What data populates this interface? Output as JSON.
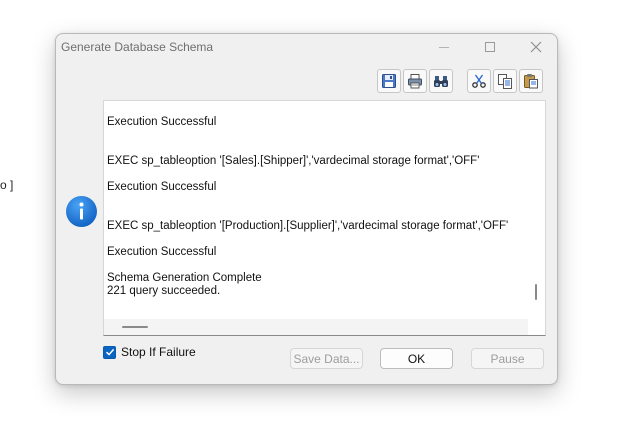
{
  "background": {
    "fragment_text": "o ]"
  },
  "dialog": {
    "title": "Generate Database Schema"
  },
  "toolbar": {
    "buttons": [
      {
        "name": "save",
        "icon": "save-icon"
      },
      {
        "name": "print",
        "icon": "print-icon"
      },
      {
        "name": "find",
        "icon": "binoculars-icon"
      },
      {
        "name": "cut",
        "icon": "scissors-icon"
      },
      {
        "name": "copy",
        "icon": "copy-icon"
      },
      {
        "name": "paste",
        "icon": "paste-icon"
      }
    ]
  },
  "log": {
    "lines": [
      "Execution Successful",
      "EXEC sp_tableoption '[Sales].[Shipper]','vardecimal storage format','OFF'",
      "Execution Successful",
      "EXEC sp_tableoption '[Production].[Supplier]','vardecimal storage format','OFF'",
      "Execution Successful",
      "Schema Generation Complete",
      "221 query succeeded."
    ]
  },
  "options": {
    "stop_if_failure_label": "Stop If Failure",
    "stop_if_failure_checked": true
  },
  "buttons": {
    "save_data": "Save Data...",
    "ok": "OK",
    "pause": "Pause"
  },
  "colors": {
    "accent": "#0a64c2",
    "info_icon": "#1e78d8"
  }
}
